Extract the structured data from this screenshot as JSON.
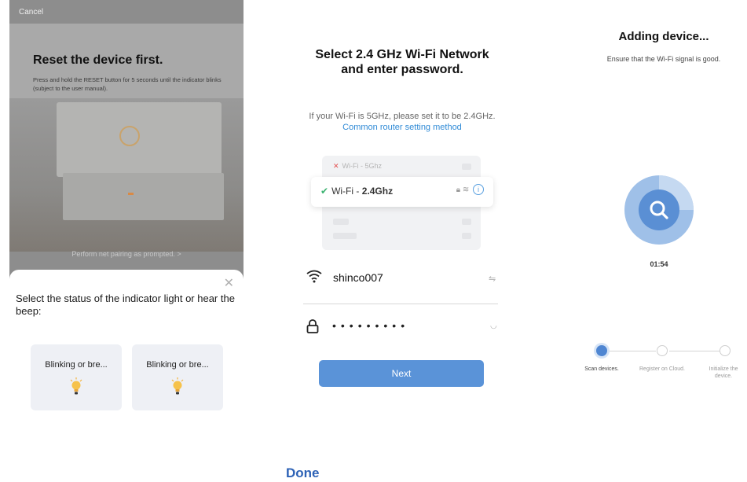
{
  "panel1": {
    "cancel_label": "Cancel",
    "title": "Reset the device first.",
    "description": "Press and hold the RESET button for 5 seconds until the indicator blinks (subject to the user manual).",
    "footer_hint": "Perform net pairing as prompted. >",
    "close_glyph": "✕",
    "question": "Select the status of the indicator light or hear the beep:",
    "options": [
      {
        "label": "Blinking or bre...",
        "icon": "lightbulb-icon"
      },
      {
        "label": "Blinking or bre...",
        "icon": "lightbulb-icon"
      }
    ]
  },
  "panel2": {
    "title": "Select 2.4 GHz Wi-Fi Network and enter password.",
    "note_prefix": "If your Wi-Fi is 5GHz, please set it to be 2.4GHz.",
    "note_link": "Common router setting method",
    "wifi_5g_label": "Wi-Fi - 5Ghz",
    "wifi_24_prefix": "Wi-Fi - ",
    "wifi_24_band": "2.4Ghz",
    "ssid": "shinco007",
    "password_mask": "•••••••••",
    "next_label": "Next"
  },
  "panel3": {
    "title": "Adding device...",
    "subtitle": "Ensure that the Wi-Fi signal is good.",
    "timer": "01:54",
    "steps": [
      {
        "label": "Scan devices.",
        "active": true
      },
      {
        "label": "Register on Cloud.",
        "active": false
      },
      {
        "label": "Initialize the device.",
        "active": false
      }
    ]
  },
  "done_label": "Done",
  "colors": {
    "accent_blue": "#5a93d8",
    "link_blue": "#2f8ad6",
    "done_blue": "#2d62b6",
    "check_green": "#3cb371",
    "error_red": "#e35050"
  }
}
